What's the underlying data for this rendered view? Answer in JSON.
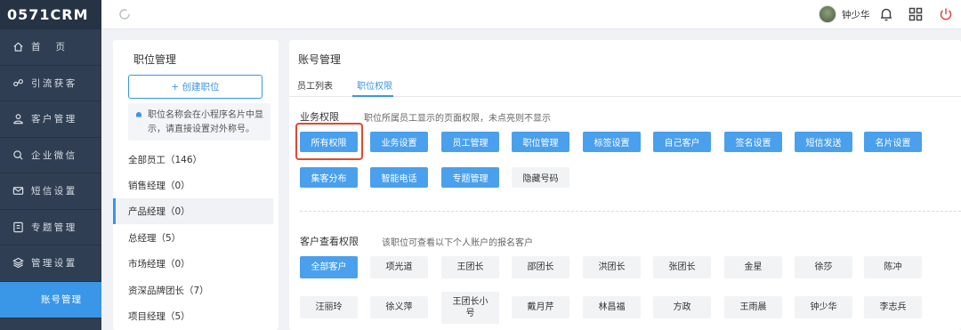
{
  "app": {
    "logo": "0571CRM"
  },
  "sidebar": {
    "items": [
      {
        "label": "首页",
        "icon": "home-icon"
      },
      {
        "label": "引流获客",
        "icon": "traffic-icon"
      },
      {
        "label": "客户管理",
        "icon": "customer-icon"
      },
      {
        "label": "企业微信",
        "icon": "wechat-icon"
      },
      {
        "label": "短信设置",
        "icon": "mail-icon"
      },
      {
        "label": "专题管理",
        "icon": "topic-icon"
      },
      {
        "label": "管理设置",
        "icon": "layers-icon"
      }
    ],
    "active_sub": "账号管理"
  },
  "topbar": {
    "user_name": "钟少华"
  },
  "left": {
    "title": "职位管理",
    "create_label": "+ 创建职位",
    "notice": "职位名称会在小程序名片中显示，请直接设置对外称号。",
    "positions": [
      "全部员工（146）",
      "销售经理（0）",
      "产品经理（0）",
      "总经理（5）",
      "市场经理（0）",
      "资深品牌团长（7）",
      "项目经理（5）"
    ]
  },
  "main": {
    "title": "账号管理",
    "tabs": [
      "员工列表",
      "职位权限"
    ],
    "biz_title": "业务权限",
    "biz_desc": "职位所属员工显示的页面权限，未点亮则不显示",
    "biz_buttons": [
      {
        "label": "所有权限",
        "on": true
      },
      {
        "label": "业务设置",
        "on": true
      },
      {
        "label": "员工管理",
        "on": true
      },
      {
        "label": "职位管理",
        "on": true
      },
      {
        "label": "标签设置",
        "on": true
      },
      {
        "label": "自己客户",
        "on": true
      },
      {
        "label": "签名设置",
        "on": true
      },
      {
        "label": "短信发送",
        "on": true
      },
      {
        "label": "名片设置",
        "on": true
      },
      {
        "label": "集客分布",
        "on": true
      },
      {
        "label": "智能电话",
        "on": true
      },
      {
        "label": "专题管理",
        "on": true
      },
      {
        "label": "隐藏号码",
        "on": false
      }
    ],
    "cust_title": "客户查看权限",
    "cust_desc": "该职位可查看以下个人账户的报名客户",
    "cust_buttons": [
      "全部客户",
      "项光道",
      "王团长",
      "邵团长",
      "洪团长",
      "张团长",
      "金星",
      "徐莎",
      "陈冲",
      "汪丽玲",
      "徐义萍",
      "王团长小号",
      "戴月芹",
      "林昌福",
      "方政",
      "王雨晨",
      "钟少华",
      "李志兵"
    ]
  },
  "colors": {
    "primary": "#4aa0ec",
    "sidebar": "#2f3e52",
    "highlight": "#e04a2a"
  }
}
